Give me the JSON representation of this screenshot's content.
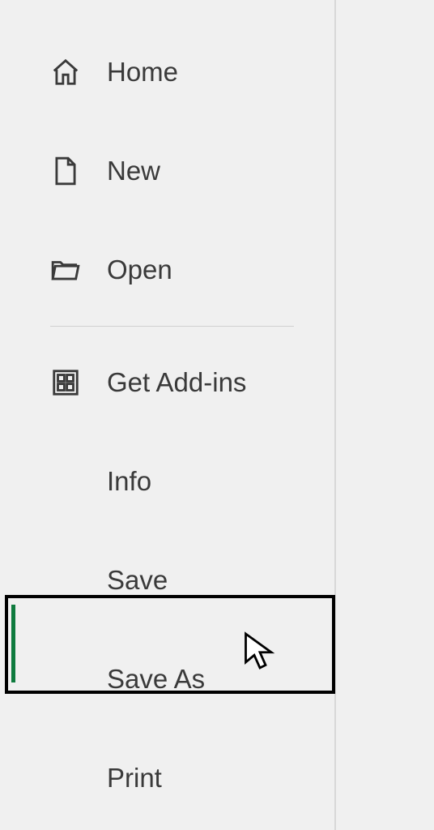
{
  "menu": {
    "home": {
      "label": "Home"
    },
    "new": {
      "label": "New"
    },
    "open": {
      "label": "Open"
    },
    "getAddins": {
      "label": "Get Add-ins"
    },
    "info": {
      "label": "Info"
    },
    "save": {
      "label": "Save"
    },
    "saveAs": {
      "label": "Save As"
    },
    "print": {
      "label": "Print"
    }
  }
}
